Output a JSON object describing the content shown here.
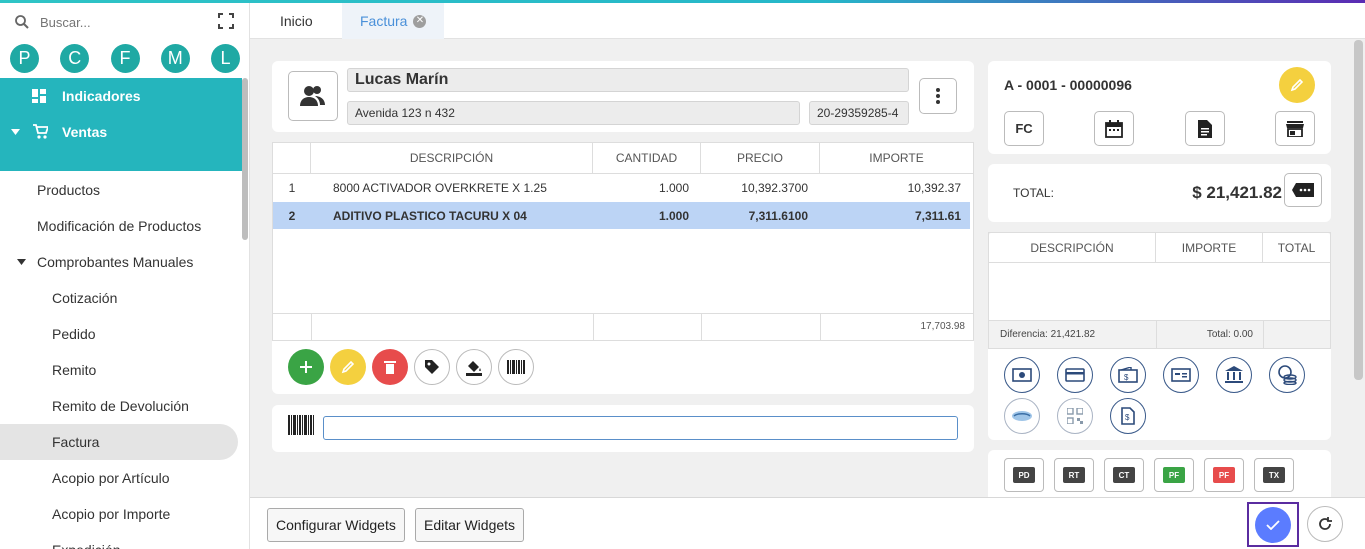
{
  "search": {
    "placeholder": "Buscar..."
  },
  "shortcuts": [
    "P",
    "C",
    "F",
    "M",
    "L"
  ],
  "menu": {
    "indicadores": "Indicadores",
    "ventas": "Ventas",
    "items": [
      "Productos",
      "Modificación de Productos"
    ],
    "comprobantes": "Comprobantes Manuales",
    "sub_items": [
      "Cotización",
      "Pedido",
      "Remito",
      "Remito de Devolución",
      "Factura",
      "Acopio por Artículo",
      "Acopio por Importe",
      "Expedición"
    ],
    "active": "Factura"
  },
  "tabs": [
    {
      "label": "Inicio"
    },
    {
      "label": "Factura"
    }
  ],
  "customer": {
    "name": "Lucas Marín",
    "address": "Avenida 123 n 432",
    "cuit": "20-29359285-4"
  },
  "grid": {
    "headers": [
      "DESCRIPCIÓN",
      "CANTIDAD",
      "PRECIO",
      "IMPORTE"
    ],
    "rows": [
      {
        "n": "1",
        "desc": "8000 ACTIVADOR OVERKRETE X 1.25",
        "qty": "1.000",
        "price": "10,392.3700",
        "amount": "10,392.37"
      },
      {
        "n": "2",
        "desc": "ADITIVO PLASTICO TACURU X 04",
        "qty": "1.000",
        "price": "7,311.6100",
        "amount": "7,311.61"
      }
    ],
    "footer_total": "17,703.98"
  },
  "invoice": {
    "number": "A - 0001 - 00000096",
    "type_label": "FC"
  },
  "total": {
    "label": "TOTAL:",
    "value": "$ 21,421.82"
  },
  "payments": {
    "headers": [
      "DESCRIPCIÓN",
      "IMPORTE",
      "TOTAL"
    ],
    "diferencia": "Diferencia: 21,421.82",
    "total": "Total: 0.00"
  },
  "docs": [
    "PD",
    "RT",
    "CT",
    "PF",
    "PF",
    "TX"
  ],
  "bottom": {
    "configurar": "Configurar Widgets",
    "editar": "Editar Widgets"
  },
  "colors": {
    "teal": "#25b5bd",
    "green": "#3aa445",
    "yellow": "#f4d03f",
    "red": "#e74c4c",
    "blue": "#5b7cff",
    "selected_row": "#bcd4f5"
  }
}
